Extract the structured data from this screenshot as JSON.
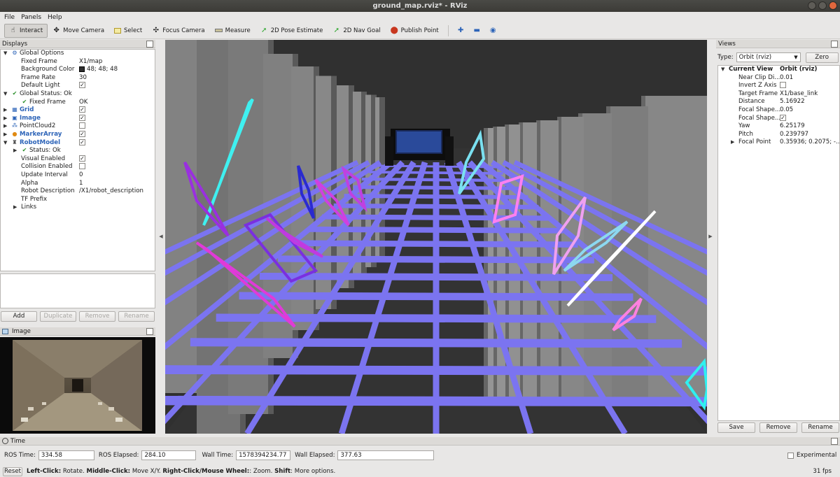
{
  "window": {
    "title": "ground_map.rviz* - RViz"
  },
  "menu": [
    {
      "label": "File"
    },
    {
      "label": "Panels"
    },
    {
      "label": "Help"
    }
  ],
  "toolbar": {
    "tools": [
      {
        "label": "Interact",
        "icon": "cursor-hand-icon",
        "active": true
      },
      {
        "label": "Move Camera",
        "icon": "move-camera-icon"
      },
      {
        "label": "Select",
        "icon": "select-box-icon"
      },
      {
        "label": "Focus Camera",
        "icon": "focus-camera-icon"
      },
      {
        "label": "Measure",
        "icon": "ruler-icon"
      },
      {
        "label": "2D Pose Estimate",
        "icon": "green-arrow-icon"
      },
      {
        "label": "2D Nav Goal",
        "icon": "green-arrow-icon"
      },
      {
        "label": "Publish Point",
        "icon": "map-pin-icon"
      }
    ],
    "extra_icons": [
      "plus-icon",
      "minus-icon",
      "eye-icon"
    ]
  },
  "displays": {
    "title": "Displays",
    "rows": [
      {
        "key": "Global Options",
        "value": "",
        "icon": "gear-icon",
        "level": 0,
        "expanded": true
      },
      {
        "key": "Fixed Frame",
        "value": "X1/map",
        "level": 1
      },
      {
        "key": "Background Color",
        "value": "48; 48; 48",
        "swatch": "#303030",
        "level": 1
      },
      {
        "key": "Frame Rate",
        "value": "30",
        "level": 1
      },
      {
        "key": "Default Light",
        "value": "",
        "check": true,
        "level": 1
      },
      {
        "key": "Global Status: Ok",
        "value": "",
        "icon": "check-icon",
        "level": 0,
        "expanded": true
      },
      {
        "key": "Fixed Frame",
        "value": "OK",
        "icon": "check-icon",
        "level": 1
      },
      {
        "key": "Grid",
        "value": "",
        "icon": "grid-icon",
        "level": 0,
        "bold": true,
        "check": true,
        "collapsed": true
      },
      {
        "key": "Image",
        "value": "",
        "icon": "image-icon",
        "level": 0,
        "bold": true,
        "check": true,
        "collapsed": true
      },
      {
        "key": "PointCloud2",
        "value": "",
        "icon": "pointcloud-icon",
        "level": 0,
        "check": false,
        "collapsed": true
      },
      {
        "key": "MarkerArray",
        "value": "",
        "icon": "marker-icon",
        "level": 0,
        "bold": true,
        "check": true,
        "collapsed": true
      },
      {
        "key": "RobotModel",
        "value": "",
        "icon": "robot-icon",
        "level": 0,
        "bold": true,
        "check": true,
        "expanded": true
      },
      {
        "key": "Status: Ok",
        "value": "",
        "icon": "check-icon",
        "level": 1,
        "collapsed": true
      },
      {
        "key": "Visual Enabled",
        "value": "",
        "check": true,
        "level": 1
      },
      {
        "key": "Collision Enabled",
        "value": "",
        "check": false,
        "level": 1
      },
      {
        "key": "Update Interval",
        "value": "0",
        "level": 1
      },
      {
        "key": "Alpha",
        "value": "1",
        "level": 1
      },
      {
        "key": "Robot Description",
        "value": "/X1/robot_description",
        "level": 1
      },
      {
        "key": "TF Prefix",
        "value": "",
        "level": 1
      },
      {
        "key": "Links",
        "value": "",
        "level": 1,
        "collapsed": true
      }
    ],
    "buttons": {
      "add": "Add",
      "duplicate": "Duplicate",
      "remove": "Remove",
      "rename": "Rename"
    }
  },
  "image_panel": {
    "title": "Image"
  },
  "views": {
    "title": "Views",
    "type_label": "Type:",
    "type_value": "Orbit (rviz)",
    "zero": "Zero",
    "rows": [
      {
        "key": "Current View",
        "value": "Orbit (rviz)",
        "bold": true,
        "level": 0,
        "expanded": true
      },
      {
        "key": "Near Clip Di...",
        "value": "0.01",
        "level": 1
      },
      {
        "key": "Invert Z Axis",
        "value": "",
        "check": false,
        "level": 1
      },
      {
        "key": "Target Frame",
        "value": "X1/base_link",
        "level": 1
      },
      {
        "key": "Distance",
        "value": "5.16922",
        "level": 1
      },
      {
        "key": "Focal Shape...",
        "value": "0.05",
        "level": 1
      },
      {
        "key": "Focal Shape...",
        "value": "",
        "check": true,
        "level": 1
      },
      {
        "key": "Yaw",
        "value": "6.25179",
        "level": 1
      },
      {
        "key": "Pitch",
        "value": "0.239797",
        "level": 1
      },
      {
        "key": "Focal Point",
        "value": "0.35936; 0.2075; -...",
        "level": 1,
        "collapsed": true
      }
    ],
    "buttons": {
      "save": "Save",
      "remove": "Remove",
      "rename": "Rename"
    }
  },
  "time": {
    "title": "Time",
    "ros_time_label": "ROS Time:",
    "ros_time": "334.58",
    "ros_elapsed_label": "ROS Elapsed:",
    "ros_elapsed": "284.10",
    "wall_time_label": "Wall Time:",
    "wall_time": "1578394234.77",
    "wall_elapsed_label": "Wall Elapsed:",
    "wall_elapsed": "377.63",
    "experimental": "Experimental"
  },
  "status": {
    "reset": "Reset",
    "hint_parts": [
      {
        "b": "Left-Click:",
        "t": " Rotate. "
      },
      {
        "b": "Middle-Click:",
        "t": " Move X/Y. "
      },
      {
        "b": "Right-Click/Mouse Wheel:",
        "t": ": Zoom. "
      },
      {
        "b": "Shift",
        "t": ": More options."
      }
    ],
    "fps": "31 fps"
  },
  "colors": {
    "viewport_bg": "#303030",
    "grid": "#7b74f0",
    "wall": "#8a8a8a"
  }
}
